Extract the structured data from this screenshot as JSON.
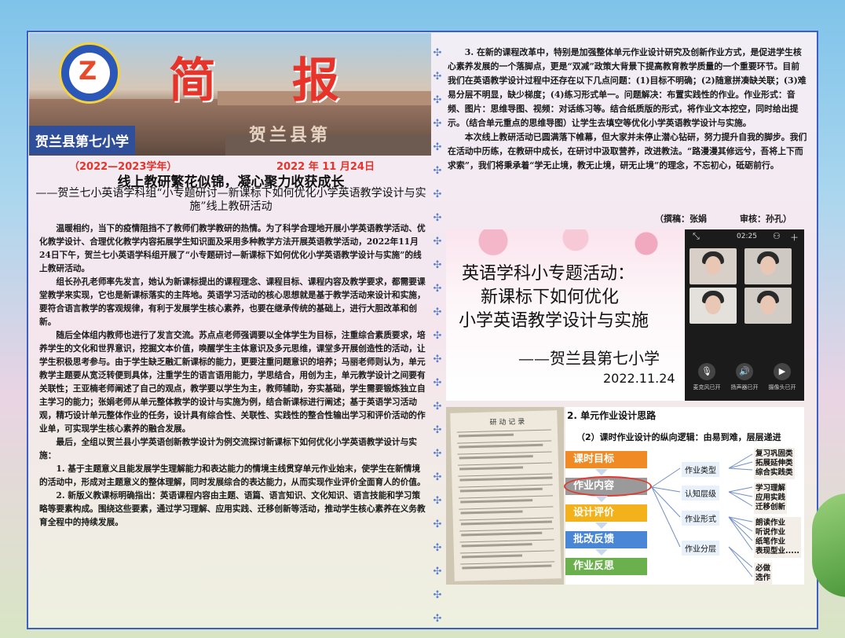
{
  "header": {
    "logo_initial": "Z",
    "logo_text": "贺兰县第七小学",
    "title": "简 报",
    "school": "贺兰县第七小学",
    "engraving": "贺兰县第"
  },
  "meta": {
    "school_year": "（2022—2023学年）",
    "date": "2022 年 11 月24日"
  },
  "article": {
    "headline": "线上教研繁花似锦，凝心聚力收获成长",
    "subhead": "——贺兰七小英语学科组“小专题研讨—新课标下如何优化小学英语教学设计与实施”线上教研活动",
    "paragraphs": [
      "温暖相约，当下的疫情阻挡不了教师们教学教研的热情。为了科学合理地开展小学英语教学活动、优化教学设计、合理优化教学内容拓展学生知识面及采用多种教学方法开展英语教学活动，2022年11月24日下午，贺兰七小英语学科组开展了“小专题研讨—新课标下如何优化小学英语教学设计与实施”的线上教研活动。",
      "组长孙孔老师率先发言，她认为新课标提出的课程理念、课程目标、课程内容及教学要求，都需要课堂教学来实现，它也是新课标落实的主阵地。英语学习活动的核心思想就是基于教学活动来设计和实施，要符合语言教学的客观规律，有利于发展学生核心素养，也要在继承传统的基础上，进行大胆改革和创新。",
      "随后全体组内教师也进行了发言交流。苏点点老师强调要以全体学生为目标，注重综合素质要求，培养学生的文化和世界意识，挖掘文本价值，唤醒学生主体意识及多元思维，课堂多开展创造性的活动，让学生积极思考参与。由于学生缺乏融汇新课标的能力，更要注重问题意识的培养；马丽老师则认为，单元教学主题要从宽泛转便到具体，注重学生的语言语用能力，学思结合，用创为主，单元教学设计之间要有关联性；王亚楠老师阐述了自己的观点，教学要以学生为主，教师辅助，夯实基础，学生需要锻炼独立自主学习的能力；张娟老师从单元整体教学的设计与实施为例，结合新课标进行阐述；基于英语学习活动观，精巧设计单元整体作业的任务，设计具有综合性、关联性、实践性的整合性输出学习和评价活动的作业单，可实现学生核心素养的融合发展。",
      "最后，全组以贺兰县小学英语创新教学设计为例交流探讨新课标下如何优化小学英语教学设计与实施：",
      "1. 基于主题意义且能发展学生理解能力和表达能力的情境主线贯穿单元作业始末，使学生在新情境的活动中，形成对主题意义的整体理解，同时发展综合的表达能力，从而实现作业评价全面育人的价值。",
      "2. 新版义教课标明确指出：英语课程内容由主题、语篇、语言知识、文化知识、语言技能和学习策略等要素构成。围绕这些要素，通过学习理解、应用实践、迁移创新等活动，推动学生核心素养在义务教育全程中的持续发展。"
    ],
    "right_paragraphs": [
      "3. 在新的课程改革中，特别是加强整体单元作业设计研究及创新作业方式，是促进学生核心素养发展的一个落脚点，更是“双减”政策大背景下提高教育教学质量的一个重要环节。目前我们在英语教学设计过程中还存在以下几点问题：(1)目标不明确；(2)随意拼凑缺关联；(3)难易分层不明显，缺少梯度；(4)练习形式单一。问题解决：布置实践性的作业。作业形式：音频、图片：思维导图、视频：对话练习等。结合纸质版的形式，将作业文本挖空，同时给出提示。（结合单元重点的思维导图）让学生去填空等优化小学英语教学设计与实施。",
      "本次线上教研活动已圆满落下帷幕，但大家并未停止潜心钻研，努力提升自我的脚步。我们在活动中历练，在教研中成长，在研讨中汲取营养，改进教法。“路漫漫其修远兮，吾将上下而求索”，我们将秉承着“学无止境，教无止境，研无止境”的理念，不忘初心，砥砺前行。"
    ],
    "author": "（撰稿：张娟",
    "reviewer": "审核：孙孔）"
  },
  "slide": {
    "line1": "英语学科小专题活动：",
    "line2": "新课标下如何优化",
    "line3": "小学英语教学设计与实施",
    "school": "——贺兰县第七小学",
    "date": "2022.11.24",
    "call_time": "02:25",
    "controls": [
      "麦克风已开",
      "扬声器已开",
      "摄像头已开"
    ]
  },
  "record": {
    "title": "研 动 记 录"
  },
  "diagram": {
    "title": "2. 单元作业设计思路",
    "subtitle": "（2）课时作业设计的纵向逻辑：由易到难，层层递进",
    "steps": [
      {
        "label": "课时目标",
        "color": "#f08a24"
      },
      {
        "label": "作业内容",
        "color": "#9a9a9a"
      },
      {
        "label": "设计评价",
        "color": "#f3b21b"
      },
      {
        "label": "批改反馈",
        "color": "#4a86d6"
      },
      {
        "label": "作业反思",
        "color": "#6ab04c"
      }
    ],
    "middle": [
      "作业类型",
      "认知层级",
      "作业形式",
      "作业分层"
    ],
    "right": [
      "复习巩固类\n拓展延伸类\n综合实践类",
      "学习理解\n应用实践\n迁移创新",
      "朗读作业\n听说作业\n纸笔作业\n表现型业.....",
      "必做\n选作"
    ]
  }
}
